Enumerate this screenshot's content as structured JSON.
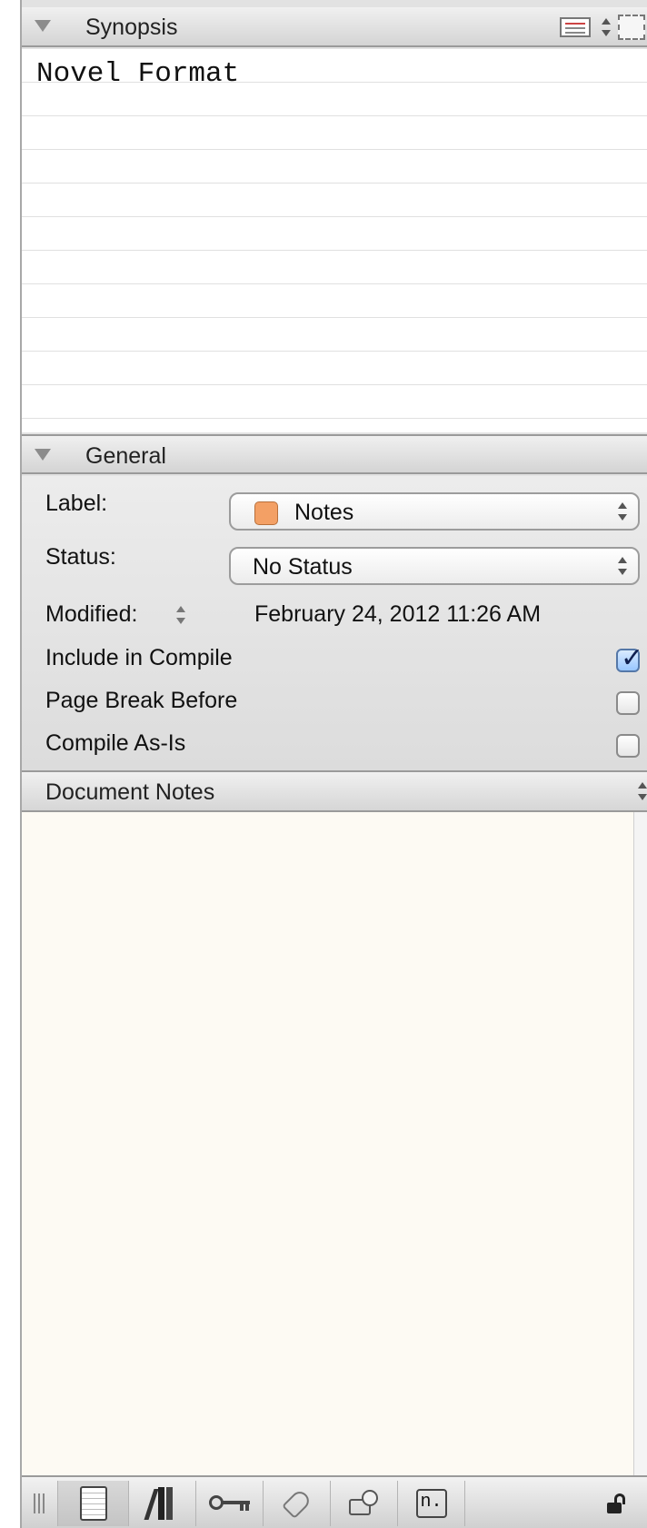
{
  "synopsis": {
    "header_label": "Synopsis",
    "text": "Novel Format"
  },
  "general": {
    "header_label": "General",
    "label_field": {
      "label": "Label:",
      "value": "Notes",
      "swatch_color": "#f3a065"
    },
    "status_field": {
      "label": "Status:",
      "value": "No Status"
    },
    "modified_field": {
      "label": "Modified:",
      "value": "February 24, 2012 11:26 AM"
    },
    "include_in_compile": {
      "label": "Include in Compile",
      "checked": true
    },
    "page_break_before": {
      "label": "Page Break Before",
      "checked": false
    },
    "compile_as_is": {
      "label": "Compile As-Is",
      "checked": false
    }
  },
  "document_notes": {
    "header_label": "Document Notes",
    "text": ""
  },
  "toolbar": {
    "buttons": [
      {
        "icon": "grip-icon"
      },
      {
        "icon": "notes-page-icon"
      },
      {
        "icon": "references-books-icon"
      },
      {
        "icon": "keywords-key-icon"
      },
      {
        "icon": "tag-icon"
      },
      {
        "icon": "snapshot-camera-icon"
      },
      {
        "icon": "comments-footnotes-icon",
        "text": "n."
      },
      {
        "icon": "lock-icon"
      }
    ]
  }
}
